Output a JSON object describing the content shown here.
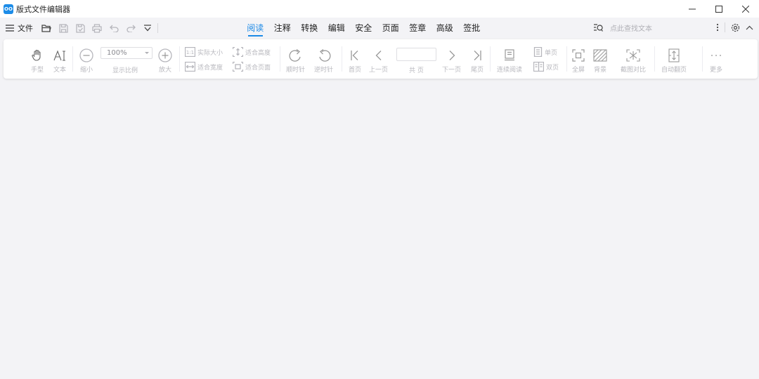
{
  "window": {
    "title": "版式文件编辑器",
    "logo_text": "OO"
  },
  "menubar": {
    "file_label": "文件",
    "tabs": [
      "阅读",
      "注释",
      "转换",
      "编辑",
      "安全",
      "页面",
      "签章",
      "高级",
      "签批"
    ],
    "active_tab": "阅读",
    "search_placeholder": "点此查找文本"
  },
  "ribbon": {
    "hand": "手型",
    "text": "文本",
    "zoom_out": "缩小",
    "zoom_value": "100%",
    "zoom_label": "显示比例",
    "zoom_in": "放大",
    "actual_size": "实际大小",
    "fit_width": "适合宽度",
    "fit_height": "适合高度",
    "fit_page": "适合页面",
    "rotate_cw": "顺时针",
    "rotate_ccw": "逆时针",
    "first_page": "首页",
    "prev_page": "上一页",
    "page_total": "共 页",
    "next_page": "下一页",
    "last_page": "尾页",
    "continuous": "连续阅读",
    "single_page": "单页",
    "double_page": "双页",
    "fullscreen": "全屏",
    "background": "背景",
    "compare": "截图对比",
    "auto_scroll": "自动翻页",
    "more": "更多"
  },
  "colors": {
    "accent": "#1d8ae6",
    "disabled_text": "#b8b8be",
    "background": "#f3f3f6"
  }
}
